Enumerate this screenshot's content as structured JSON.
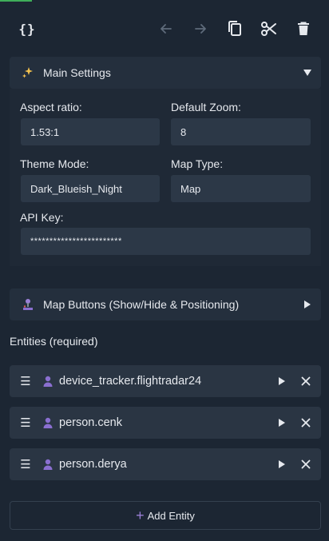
{
  "toolbar": {
    "code_label": "{}",
    "icons": [
      "code-icon",
      "undo-icon",
      "redo-icon",
      "copy-icon",
      "cut-icon",
      "delete-icon"
    ]
  },
  "main_settings": {
    "title": "Main Settings",
    "icon": "sparkles-icon",
    "aspect_ratio": {
      "label": "Aspect ratio:",
      "value": "1.53:1"
    },
    "default_zoom": {
      "label": "Default Zoom:",
      "value": "8"
    },
    "theme_mode": {
      "label": "Theme Mode:",
      "value": "Dark_Blueish_Night"
    },
    "map_type": {
      "label": "Map Type:",
      "value": "Map"
    },
    "api_key": {
      "label": "API Key:",
      "value": "************************"
    }
  },
  "map_buttons": {
    "title": "Map Buttons (Show/Hide & Positioning)",
    "icon": "joystick-icon"
  },
  "entities": {
    "label": "Entities (required)",
    "items": [
      {
        "name": "device_tracker.flightradar24"
      },
      {
        "name": "person.cenk"
      },
      {
        "name": "person.derya"
      }
    ],
    "add_label": "Add Entity"
  },
  "colors": {
    "background": "#1c2633",
    "panel": "#242f3d",
    "field": "#2c3847",
    "accent_purple": "#9a7fd6",
    "accent_green": "#3fae5a"
  }
}
